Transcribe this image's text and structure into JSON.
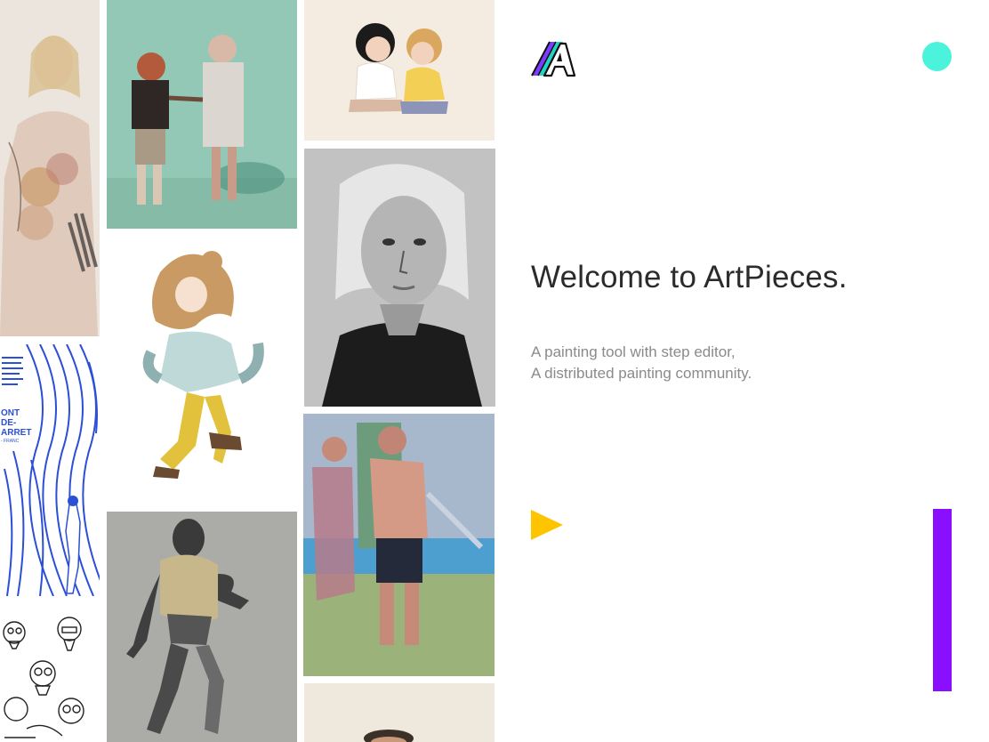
{
  "brand": {
    "logo_letter": "A",
    "accent_teal": "#4cf3dc",
    "accent_yellow": "#ffc400",
    "accent_purple": "#8a0fff"
  },
  "hero": {
    "title": "Welcome to ArtPieces.",
    "description_lines": [
      "A painting tool with step editor,",
      "A distributed painting community."
    ]
  },
  "gallery": {
    "artworks": [
      {
        "id": "t1",
        "subject": "girl-portrait-watercolor"
      },
      {
        "id": "t2",
        "subject": "blue-line-poster"
      },
      {
        "id": "t3",
        "subject": "gas-mask-sketches"
      },
      {
        "id": "t4",
        "subject": "two-children-painting"
      },
      {
        "id": "t5",
        "subject": "anime-girl-illustration"
      },
      {
        "id": "t6",
        "subject": "armored-figure-concept"
      },
      {
        "id": "t7",
        "subject": "two-kids-cartoon"
      },
      {
        "id": "t8",
        "subject": "bw-girl-portrait"
      },
      {
        "id": "t9",
        "subject": "beach-figures-painting"
      },
      {
        "id": "t10",
        "subject": "partial-painting"
      }
    ],
    "poster_text": [
      "ONT",
      "DE-",
      "ARRET",
      "- FRANC"
    ]
  },
  "icons": {
    "logo": "artpieces-logo-icon",
    "profile": "profile-dot-icon",
    "play": "play-icon"
  }
}
